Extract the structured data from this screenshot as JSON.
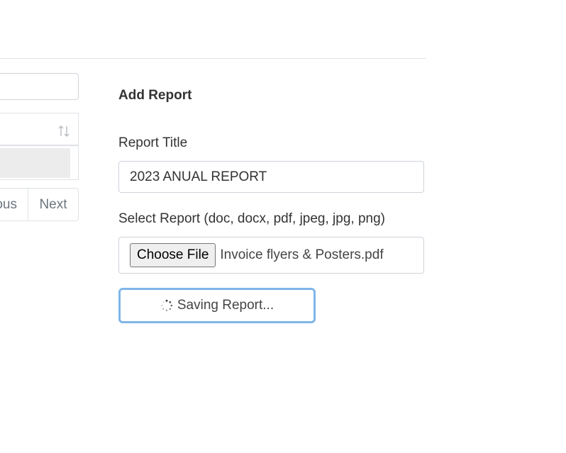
{
  "left_panel": {
    "pagination": {
      "previous_label": "Previous",
      "next_label": "Next"
    },
    "sort_icon": "sort-arrows-icon"
  },
  "form": {
    "heading": "Add Report",
    "report_title": {
      "label": "Report Title",
      "value": "2023 ANUAL REPORT"
    },
    "report_file": {
      "label": "Select Report (doc, docx, pdf, jpeg, jpg, png)",
      "button_label": "Choose File",
      "file_name": "Invoice flyers & Posters.pdf"
    },
    "submit": {
      "label": "Saving Report...",
      "icon": "spinner-icon",
      "accent_color": "#7fb6ea"
    }
  }
}
